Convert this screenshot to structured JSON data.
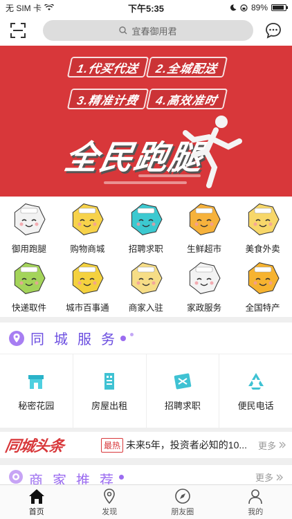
{
  "status": {
    "carrier": "无 SIM 卡",
    "time": "下午5:35",
    "battery": "89%",
    "battery_level": 0.89
  },
  "header": {
    "search_placeholder": "宜春御用君"
  },
  "banner": {
    "tags": [
      "1.代买代送",
      "2.全城配送",
      "3.精准计费",
      "4.高效准时"
    ],
    "title": "全民跑腿",
    "color": "#d8373a"
  },
  "grid": [
    {
      "label": "御用跑腿",
      "icon": "face-cloud-icon",
      "color": "#f2f2f2"
    },
    {
      "label": "购物商城",
      "icon": "face-yellow-icon",
      "color": "#f7d24a"
    },
    {
      "label": "招聘求职",
      "icon": "face-cyan-icon",
      "color": "#3cc9d0"
    },
    {
      "label": "生鲜超市",
      "icon": "face-orange-icon",
      "color": "#f6b23c"
    },
    {
      "label": "美食外卖",
      "icon": "face-lightyellow-icon",
      "color": "#f7d76a"
    },
    {
      "label": "快递取件",
      "icon": "face-green-icon",
      "color": "#a4d45a"
    },
    {
      "label": "城市百事通",
      "icon": "face-yellow2-icon",
      "color": "#f4d13e"
    },
    {
      "label": "商家入驻",
      "icon": "face-pale-icon",
      "color": "#f6dd86"
    },
    {
      "label": "家政服务",
      "icon": "face-white-icon",
      "color": "#f3f3f3"
    },
    {
      "label": "全国特产",
      "icon": "face-amber-icon",
      "color": "#f6b330"
    }
  ],
  "service": {
    "title": "同城服务",
    "items": [
      {
        "label": "秘密花园",
        "icon": "shop-icon"
      },
      {
        "label": "房屋出租",
        "icon": "building-icon"
      },
      {
        "label": "招聘求职",
        "icon": "card-icon"
      },
      {
        "label": "便民电话",
        "icon": "recycle-icon"
      }
    ]
  },
  "news": {
    "logo": "同城头条",
    "badge": "最热",
    "headline": "未来5年，投资者必知的10...",
    "more": "更多"
  },
  "merchant": {
    "title": "商家推荐",
    "more": "更多"
  },
  "tabs": [
    {
      "label": "首页",
      "icon": "home-icon"
    },
    {
      "label": "发现",
      "icon": "location-icon"
    },
    {
      "label": "朋友圈",
      "icon": "compass-icon"
    },
    {
      "label": "我的",
      "icon": "person-icon"
    }
  ]
}
